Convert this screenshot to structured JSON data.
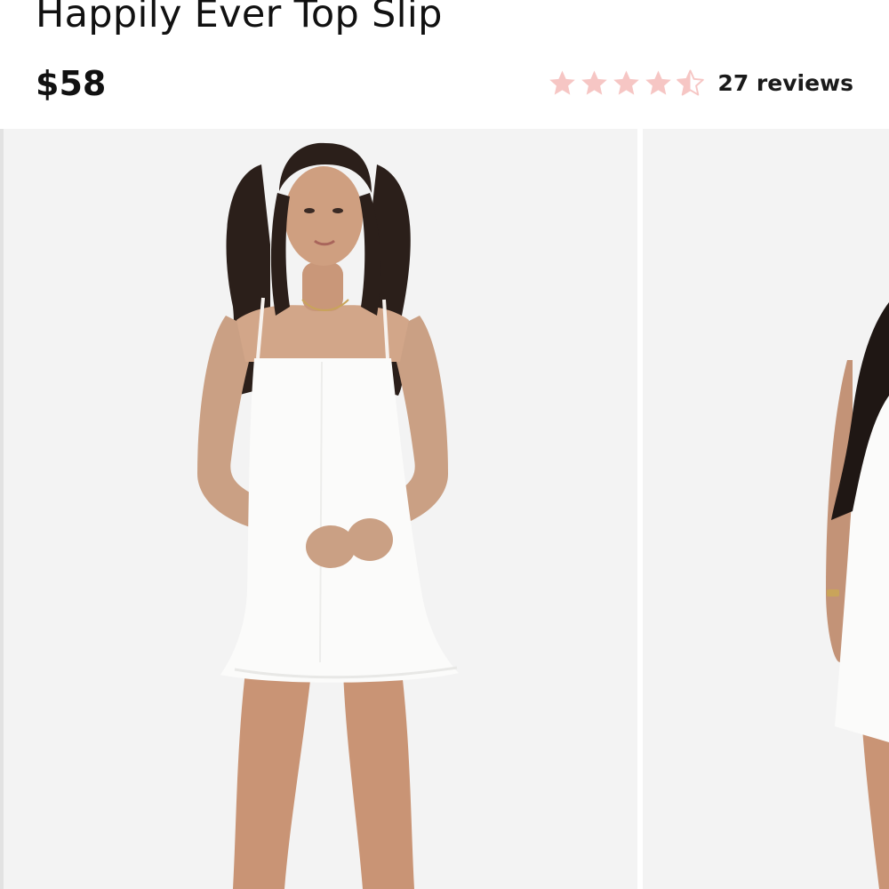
{
  "product": {
    "title": "Happily Ever Top Slip",
    "price": "$58"
  },
  "rating": {
    "value": 4.5,
    "max": 5,
    "reviews_label": "27 reviews",
    "star_color": "#f6c6c4"
  },
  "gallery": {
    "images": [
      {
        "icon": "model-front-photo"
      },
      {
        "icon": "model-side-photo"
      }
    ]
  }
}
